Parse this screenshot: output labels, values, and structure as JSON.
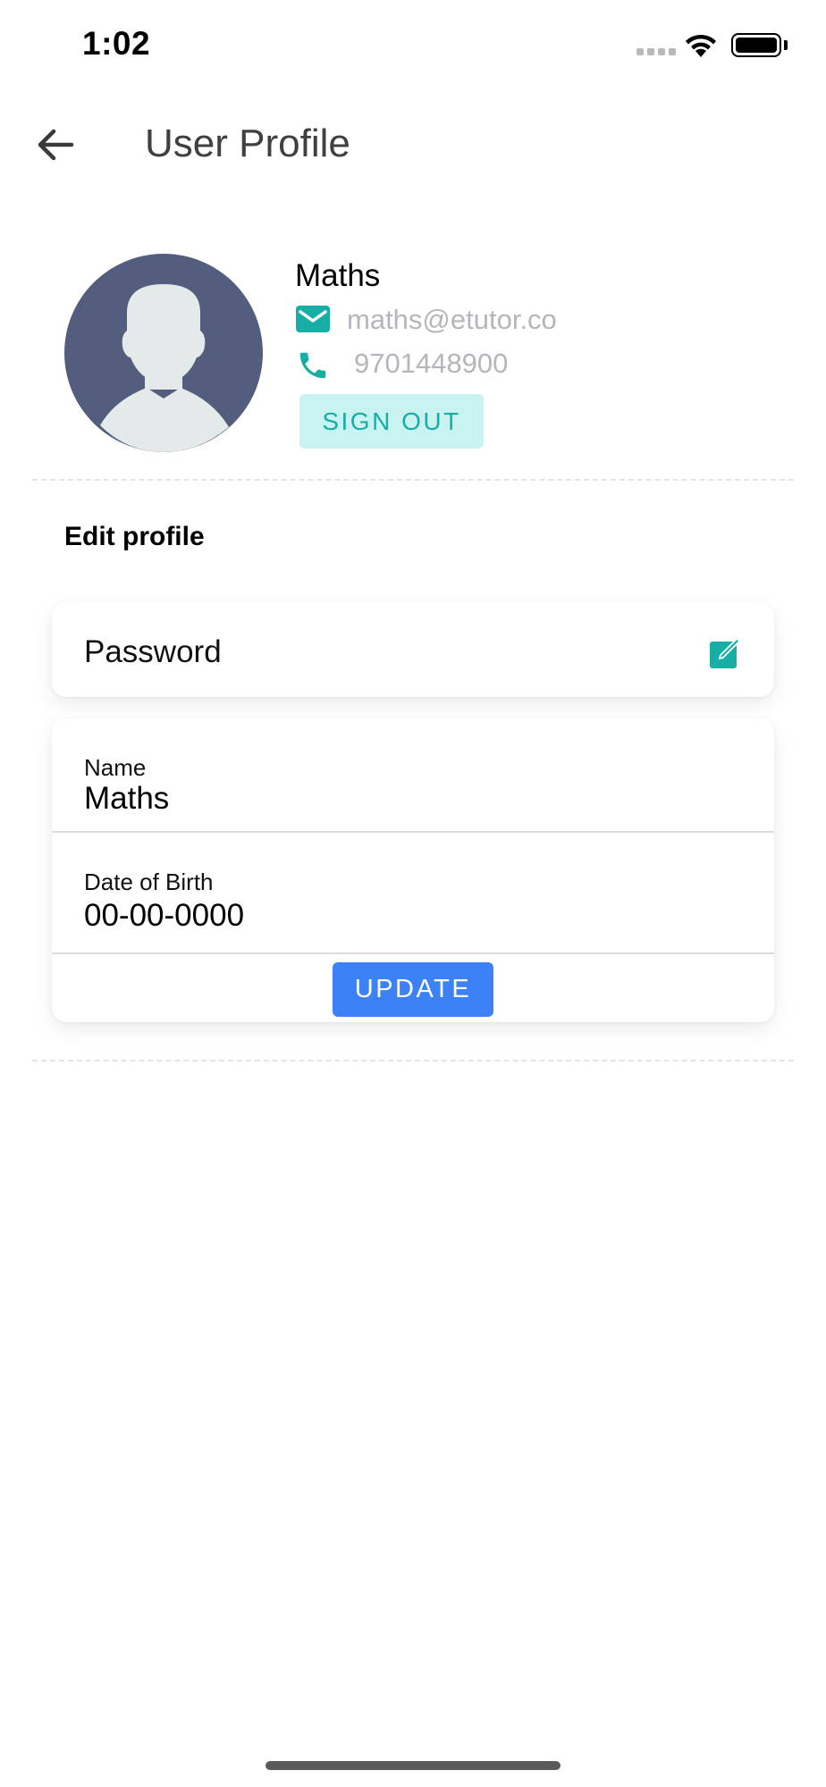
{
  "status_bar": {
    "time": "1:02"
  },
  "header": {
    "title": "User Profile",
    "back_icon": "arrow-left-icon"
  },
  "profile": {
    "name": "Maths",
    "email": "maths@etutor.co",
    "phone": "9701448900",
    "email_icon": "envelope-icon",
    "phone_icon": "phone-icon",
    "sign_out_label": "SIGN OUT"
  },
  "edit_profile": {
    "section_title": "Edit profile",
    "password_label": "Password",
    "password_icon": "edit-icon",
    "fields": [
      {
        "label": "Name",
        "value": "Maths"
      },
      {
        "label": "Date of Birth",
        "value": "00-00-0000"
      }
    ],
    "update_label": "UPDATE"
  },
  "colors": {
    "accent_teal": "#17aea6",
    "sign_out_bg": "#c9f3f0",
    "update_blue": "#3c82f6",
    "avatar_bg": "#535d7d",
    "secondary_text": "#b5b5be"
  }
}
